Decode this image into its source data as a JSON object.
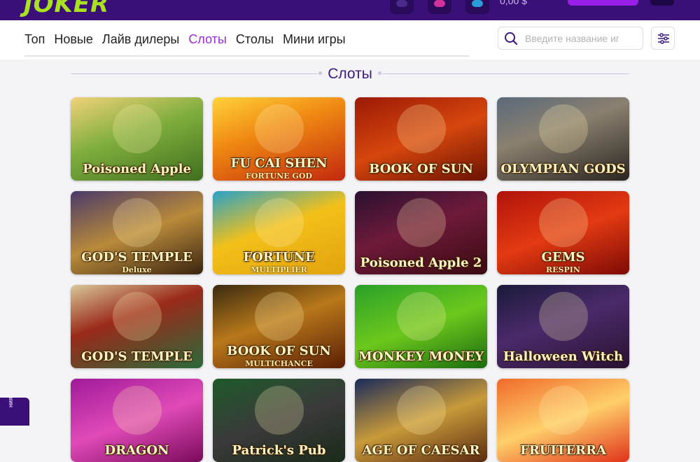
{
  "header": {
    "logo_text": "JOKER",
    "balance": "0,00 $"
  },
  "nav": {
    "tabs": [
      {
        "label": "Топ",
        "active": false
      },
      {
        "label": "Новые",
        "active": false
      },
      {
        "label": "Лайв дилеры",
        "active": false
      },
      {
        "label": "Слоты",
        "active": true
      },
      {
        "label": "Столы",
        "active": false
      },
      {
        "label": "Мини игры",
        "active": false
      }
    ],
    "search_placeholder": "Введите название иг"
  },
  "section": {
    "title": "Слоты"
  },
  "games": [
    {
      "name": "Poisoned Apple",
      "sub": "",
      "bg": "linear-gradient(160deg,#f1d27a 0%,#7fae3d 45%,#3f6f1e 100%)"
    },
    {
      "name": "FU CAI SHEN",
      "sub": "FORTUNE GOD",
      "bg": "linear-gradient(160deg,#ffd23a 0%,#f08a12 40%,#c2280e 100%)"
    },
    {
      "name": "BOOK OF SUN",
      "sub": "",
      "bg": "linear-gradient(160deg,#9b1a06 0%,#d6460d 50%,#6a1203 100%)"
    },
    {
      "name": "OLYMPIAN GODS",
      "sub": "",
      "bg": "linear-gradient(160deg,#5a6a7a 0%,#8a8070 40%,#2a2620 100%)"
    },
    {
      "name": "GOD'S TEMPLE",
      "sub": "Deluxe",
      "bg": "linear-gradient(160deg,#4a3a6a 0%,#b98a3a 50%,#3a2410 100%)"
    },
    {
      "name": "FORTUNE",
      "sub": "MULTIPLIER",
      "bg": "linear-gradient(160deg,#2aa2c8 0%,#f3c019 45%,#e2a30e 100%)"
    },
    {
      "name": "Poisoned Apple 2",
      "sub": "",
      "bg": "linear-gradient(160deg,#2a1030 0%,#6e1a3a 45%,#3a0a10 100%)"
    },
    {
      "name": "GEMS",
      "sub": "RESPIN",
      "bg": "linear-gradient(160deg,#b0130a 0%,#e33a12 50%,#7e0a05 100%)"
    },
    {
      "name": "GOD'S TEMPLE",
      "sub": "",
      "bg": "linear-gradient(160deg,#d9c79a 0%,#9a2a1a 40%,#2a6a3a 100%)"
    },
    {
      "name": "BOOK OF SUN",
      "sub": "MULTICHANCE",
      "bg": "linear-gradient(160deg,#3a2a10 0%,#b8781a 45%,#5a1e05 100%)"
    },
    {
      "name": "MONKEY MONEY",
      "sub": "",
      "bg": "linear-gradient(160deg,#2aa02a 0%,#6cc81c 50%,#1a6a10 100%)"
    },
    {
      "name": "Halloween Witch",
      "sub": "",
      "bg": "linear-gradient(160deg,#1a1a3a 0%,#4a2a6a 45%,#2a1230 100%)"
    },
    {
      "name": "DRAGON",
      "sub": "",
      "bg": "linear-gradient(160deg,#a01a9a 0%,#e04ab8 50%,#7a0a5a 100%)"
    },
    {
      "name": "Patrick's Pub",
      "sub": "",
      "bg": "linear-gradient(160deg,#1e5a2a 0%,#3a3a3a 50%,#1a2a1a 100%)"
    },
    {
      "name": "AGE OF CAESAR",
      "sub": "",
      "bg": "linear-gradient(160deg,#1a2a5a 0%,#c89a3a 50%,#5a2a10 100%)"
    },
    {
      "name": "FRUITERRA",
      "sub": "",
      "bg": "linear-gradient(160deg,#f06a2a 0%,#ffcf6a 50%,#e0321a 100%)"
    }
  ],
  "side_tab": {
    "label": "ния"
  }
}
